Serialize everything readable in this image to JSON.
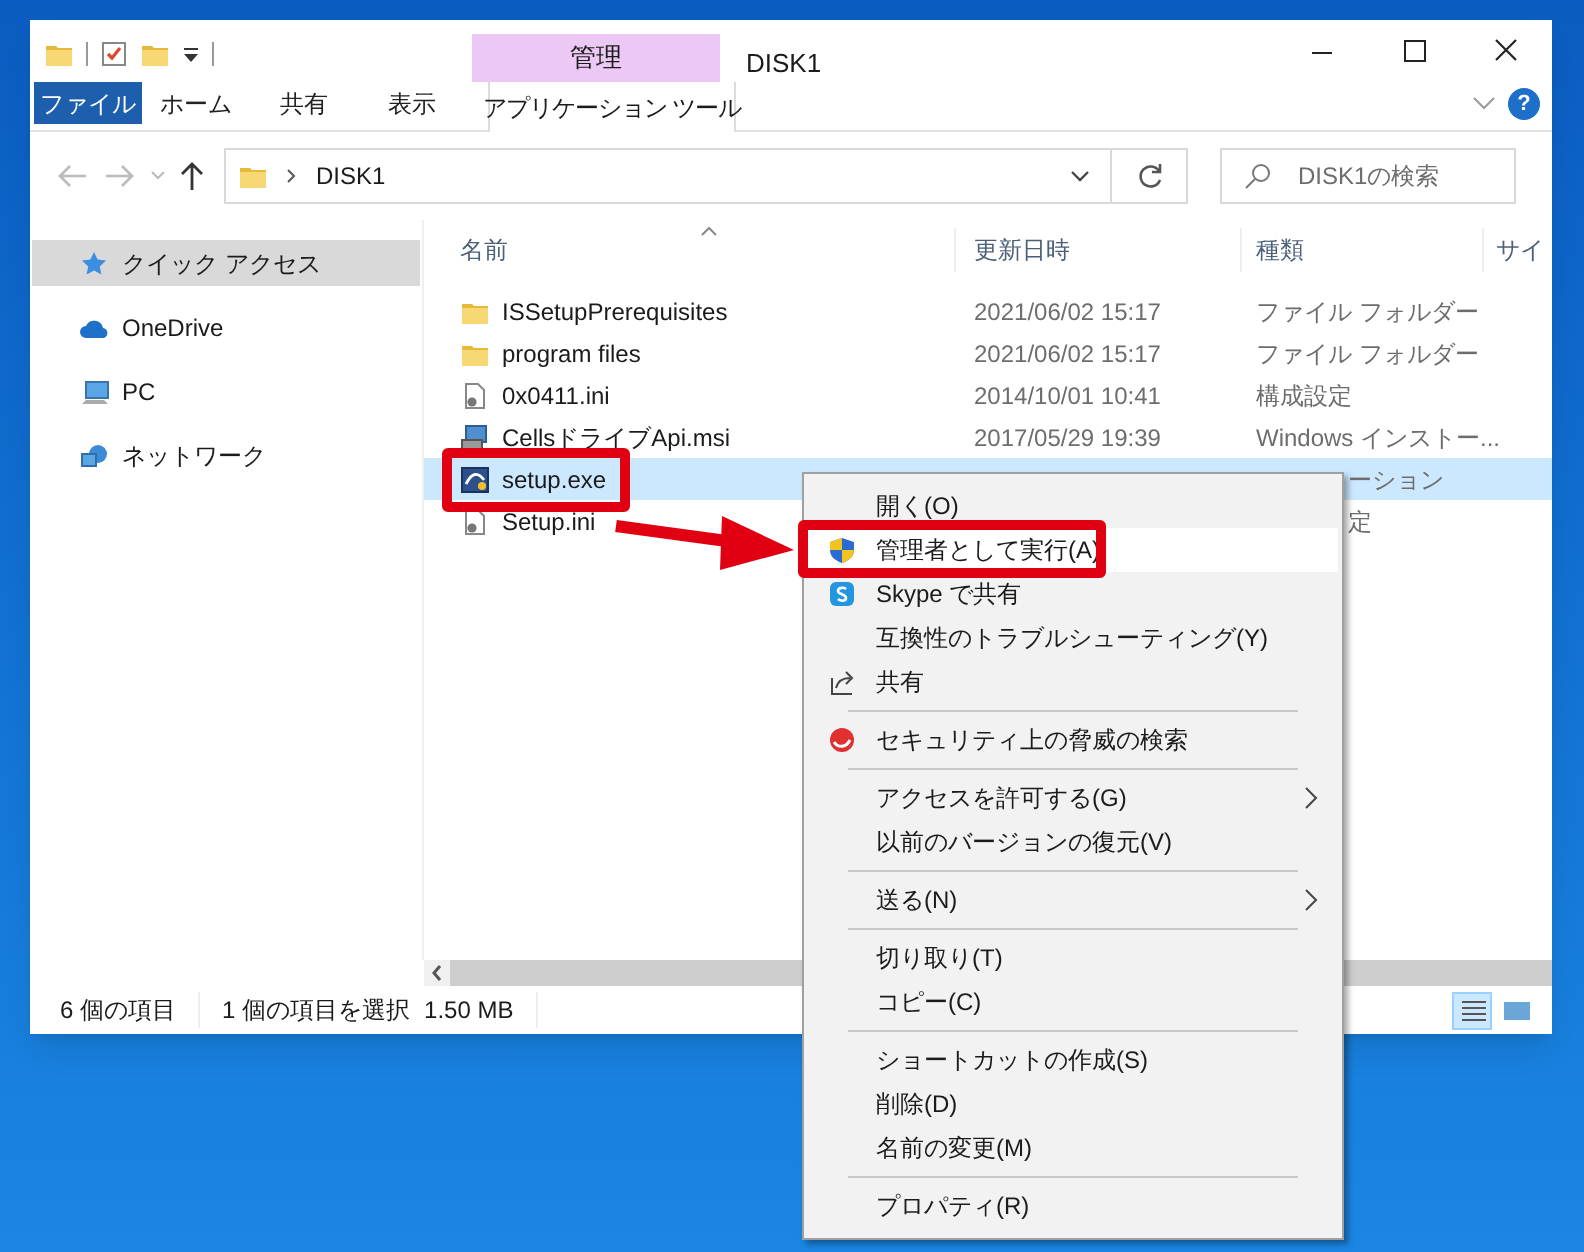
{
  "window": {
    "title": "DISK1"
  },
  "ribbon": {
    "context_group": "管理",
    "help": "?",
    "tabs": [
      {
        "label": "ファイル",
        "kind": "file"
      },
      {
        "label": "ホーム",
        "kind": "normal"
      },
      {
        "label": "共有",
        "kind": "normal"
      },
      {
        "label": "表示",
        "kind": "normal"
      },
      {
        "label": "アプリケーション ツール",
        "kind": "context"
      }
    ]
  },
  "address_bar": {
    "path": [
      "DISK1"
    ]
  },
  "search": {
    "placeholder": "DISK1の検索"
  },
  "navigation_pane": {
    "items": [
      {
        "label": "クイック アクセス",
        "selected": true
      },
      {
        "label": "OneDrive",
        "selected": false
      },
      {
        "label": "PC",
        "selected": false
      },
      {
        "label": "ネットワーク",
        "selected": false
      }
    ]
  },
  "file_list": {
    "columns": [
      "名前",
      "更新日時",
      "種類",
      "サイ"
    ],
    "rows": [
      {
        "kind": "folder",
        "name": "ISSetupPrerequisites",
        "date": "2021/06/02 15:17",
        "type": "ファイル フォルダー",
        "selected": false
      },
      {
        "kind": "folder",
        "name": "program files",
        "date": "2021/06/02 15:17",
        "type": "ファイル フォルダー",
        "selected": false
      },
      {
        "kind": "config",
        "name": "0x0411.ini",
        "date": "2014/10/01 10:41",
        "type": "構成設定",
        "selected": false
      },
      {
        "kind": "installer",
        "name": "CellsドライブApi.msi",
        "date": "2017/05/29 19:39",
        "type": "Windows インストー...",
        "selected": false
      },
      {
        "kind": "application",
        "name": "setup.exe",
        "type_tail": "ーション",
        "selected": true
      },
      {
        "kind": "config",
        "name": "Setup.ini",
        "type_tail": "定",
        "selected": false
      }
    ]
  },
  "context_menu": {
    "items": [
      {
        "kind": "command",
        "label": "開く(O)",
        "highlighted": false
      },
      {
        "kind": "command",
        "label": "管理者として実行(A)",
        "highlighted": true
      },
      {
        "kind": "command",
        "label": "Skype で共有",
        "highlighted": false
      },
      {
        "kind": "command",
        "label": "互換性のトラブルシューティング(Y)",
        "highlighted": false
      },
      {
        "kind": "command",
        "label": "共有",
        "highlighted": false
      },
      {
        "kind": "separator"
      },
      {
        "kind": "command",
        "label": "セキュリティ上の脅威の検索",
        "highlighted": false
      },
      {
        "kind": "separator"
      },
      {
        "kind": "submenu",
        "label": "アクセスを許可する(G)",
        "highlighted": false
      },
      {
        "kind": "command",
        "label": "以前のバージョンの復元(V)",
        "highlighted": false
      },
      {
        "kind": "separator"
      },
      {
        "kind": "submenu",
        "label": "送る(N)",
        "highlighted": false
      },
      {
        "kind": "separator"
      },
      {
        "kind": "command",
        "label": "切り取り(T)",
        "highlighted": false
      },
      {
        "kind": "command",
        "label": "コピー(C)",
        "highlighted": false
      },
      {
        "kind": "separator"
      },
      {
        "kind": "command",
        "label": "ショートカットの作成(S)",
        "highlighted": false
      },
      {
        "kind": "command",
        "label": "削除(D)",
        "highlighted": false
      },
      {
        "kind": "command",
        "label": "名前の変更(M)",
        "highlighted": false
      },
      {
        "kind": "separator"
      },
      {
        "kind": "command",
        "label": "プロパティ(R)",
        "highlighted": false
      }
    ]
  },
  "status_bar": {
    "item_count": "6 個の項目",
    "selection": "1 個の項目を選択",
    "size": "1.50 MB"
  },
  "view_buttons": [
    {
      "kind": "details",
      "selected": true
    },
    {
      "kind": "large_icons",
      "selected": false
    }
  ]
}
